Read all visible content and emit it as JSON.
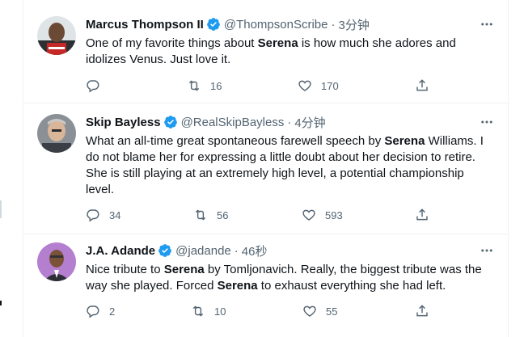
{
  "tweets": [
    {
      "name": "Marcus Thompson II",
      "handle": "@ThompsonScribe",
      "separator": "·",
      "time": "3分钟",
      "lines": [
        [
          {
            "t": "One of my favorite things about "
          },
          {
            "t": "Serena",
            "b": true
          },
          {
            "t": " is how much she adores and"
          }
        ],
        [
          {
            "t": "idolizes Venus. Just love it."
          }
        ]
      ],
      "reply_count": "",
      "retweet_count": "16",
      "like_count": "170"
    },
    {
      "name": "Skip Bayless",
      "handle": "@RealSkipBayless",
      "separator": "·",
      "time": "4分钟",
      "lines": [
        [
          {
            "t": "What an all-time great spontaneous farewell speech by "
          },
          {
            "t": "Serena",
            "b": true
          },
          {
            "t": " Williams. I"
          }
        ],
        [
          {
            "t": "do not blame her for expressing a little doubt about her decision to retire."
          }
        ],
        [
          {
            "t": "She is still playing at an extremely high level, a potential championship"
          }
        ],
        [
          {
            "t": "level."
          }
        ]
      ],
      "reply_count": "34",
      "retweet_count": "56",
      "like_count": "593"
    },
    {
      "name": "J.A. Adande",
      "handle": "@jadande",
      "separator": "·",
      "time": "46秒",
      "lines": [
        [
          {
            "t": "Nice tribute to "
          },
          {
            "t": "Serena",
            "b": true
          },
          {
            "t": " by Tomljonavich. Really, the biggest tribute was the"
          }
        ],
        [
          {
            "t": "way she played. Forced "
          },
          {
            "t": "Serena",
            "b": true
          },
          {
            "t": " to exhaust everything she had left."
          }
        ]
      ],
      "reply_count": "2",
      "retweet_count": "10",
      "like_count": "55"
    }
  ],
  "colors": {
    "verified": "#1d9bf0",
    "secondary_text": "#536471",
    "divider": "#eff3f4"
  },
  "icons": [
    "verified-badge-icon",
    "more-icon",
    "reply-icon",
    "retweet-icon",
    "like-icon",
    "share-icon"
  ]
}
